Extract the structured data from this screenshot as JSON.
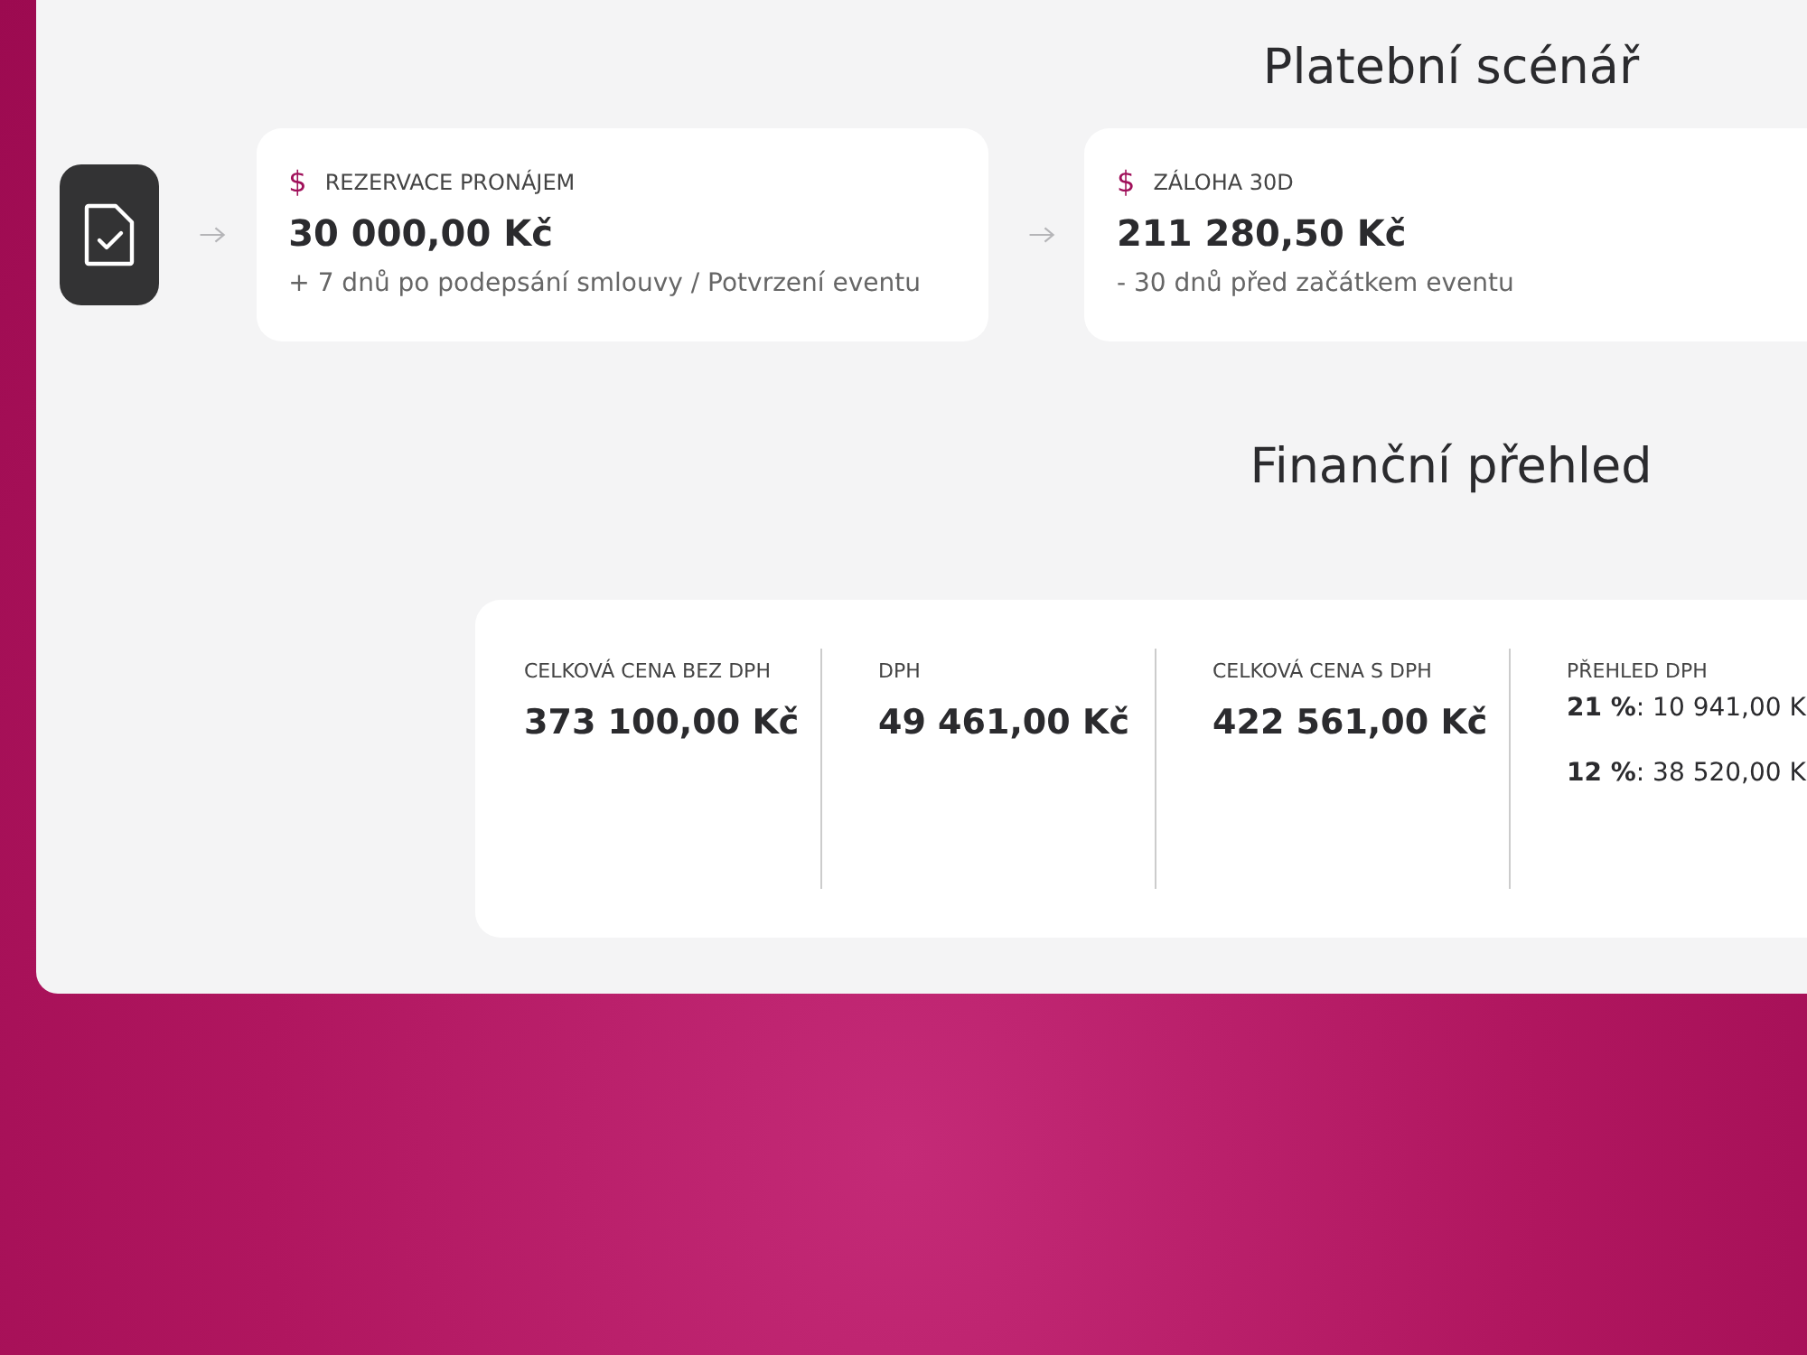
{
  "payment_scenario": {
    "title": "Platební scénář",
    "steps": [
      {
        "icon": "$",
        "label": "REZERVACE PRONÁJEM",
        "amount": "30 000,00 Kč",
        "note": "+ 7 dnů po podepsání smlouvy / Potvrzení eventu"
      },
      {
        "icon": "$",
        "label": "ZÁLOHA 30D",
        "amount": "211 280,50 Kč",
        "note": "- 30 dnů před začátkem eventu"
      }
    ]
  },
  "financial_overview": {
    "title": "Finanční přehled",
    "columns": [
      {
        "label": "CELKOVÁ CENA BEZ DPH",
        "values": [
          "373 100,00 Kč"
        ],
        "kind": "total"
      },
      {
        "label": "DPH",
        "values": [
          "49 461,00 Kč"
        ],
        "kind": "total"
      },
      {
        "label": "CELKOVÁ CENA S DPH",
        "values": [
          "422 561,00 Kč"
        ],
        "kind": "total"
      },
      {
        "label": "PŘEHLED DPH",
        "values": [
          "**21 %**: 10 941,00 K",
          "**12 %**: 38 520,00 K"
        ],
        "kind": "breakdown"
      }
    ]
  }
}
